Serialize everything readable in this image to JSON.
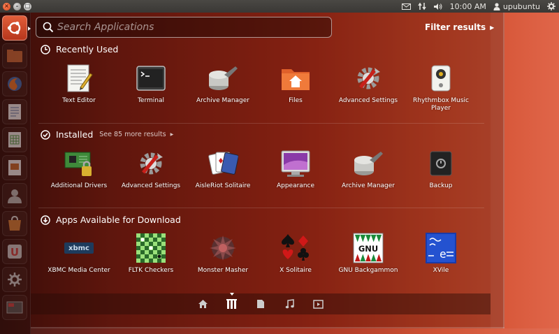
{
  "panel": {
    "clock": "10:00 AM",
    "user": "upubuntu"
  },
  "search": {
    "placeholder": "Search Applications",
    "value": ""
  },
  "filter": {
    "label": "Filter results"
  },
  "sections": {
    "recent": {
      "title": "Recently Used",
      "apps": [
        {
          "label": "Text Editor",
          "icon": "text-editor-icon"
        },
        {
          "label": "Terminal",
          "icon": "terminal-icon"
        },
        {
          "label": "Archive Manager",
          "icon": "archive-manager-icon"
        },
        {
          "label": "Files",
          "icon": "files-icon"
        },
        {
          "label": "Advanced Settings",
          "icon": "advanced-settings-icon"
        },
        {
          "label": "Rhythmbox Music Player",
          "icon": "rhythmbox-icon"
        }
      ]
    },
    "installed": {
      "title": "Installed",
      "see_more": "See 85 more results",
      "apps": [
        {
          "label": "Additional Drivers",
          "icon": "additional-drivers-icon"
        },
        {
          "label": "Advanced Settings",
          "icon": "advanced-settings-icon"
        },
        {
          "label": "AisleRiot Solitaire",
          "icon": "solitaire-icon"
        },
        {
          "label": "Appearance",
          "icon": "appearance-icon"
        },
        {
          "label": "Archive Manager",
          "icon": "archive-manager-icon"
        },
        {
          "label": "Backup",
          "icon": "backup-icon"
        }
      ]
    },
    "download": {
      "title": "Apps Available for Download",
      "apps": [
        {
          "label": "XBMC Media Center",
          "icon": "xbmc-icon"
        },
        {
          "label": "FLTK Checkers",
          "icon": "checkers-icon"
        },
        {
          "label": "Monster Masher",
          "icon": "monster-masher-icon"
        },
        {
          "label": "X Solitaire",
          "icon": "x-solitaire-icon"
        },
        {
          "label": "GNU Backgammon",
          "icon": "gnu-backgammon-icon",
          "badge": "GNU"
        },
        {
          "label": "XVile",
          "icon": "xvile-icon",
          "badge": "e"
        }
      ]
    }
  },
  "colors": {
    "accent": "#dd4814",
    "panel": "#3c3b37"
  }
}
